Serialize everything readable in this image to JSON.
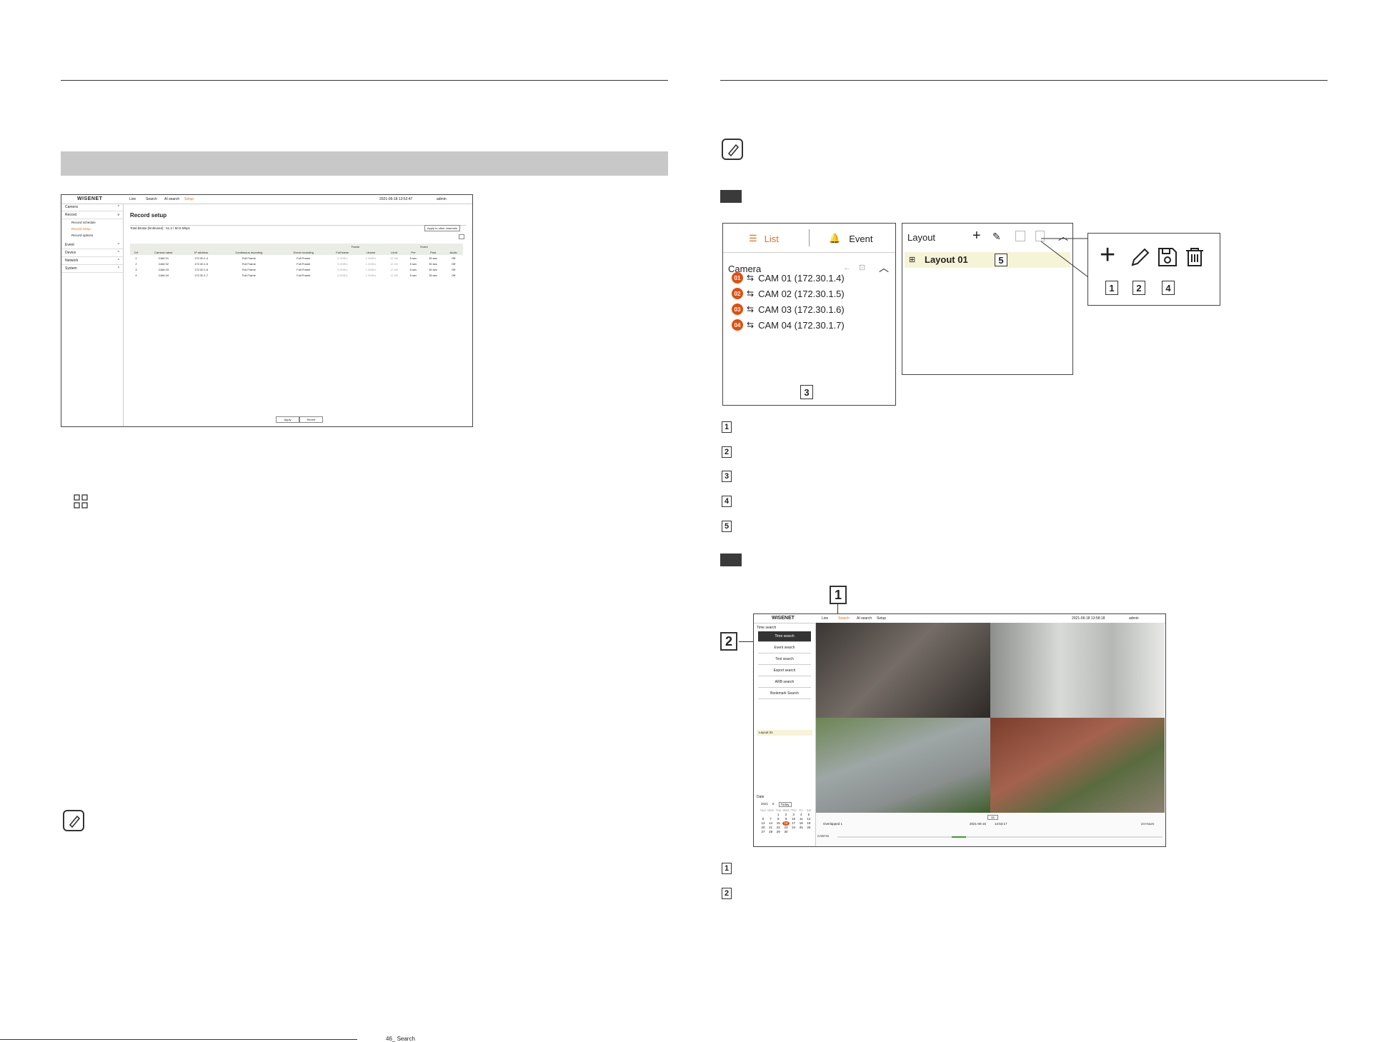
{
  "left_page": {
    "record_setup_screenshot": {
      "brand": "WISENET",
      "nav": [
        "Live",
        "Search",
        "AI search",
        "Setup"
      ],
      "datetime": "2021-06-18 13:52:47",
      "user": "admin",
      "sidebar": [
        {
          "label": "Camera",
          "sub": []
        },
        {
          "label": "Record",
          "sub": [
            "Record schedule",
            "Record setup",
            "Record options"
          ]
        },
        {
          "label": "Event",
          "sub": []
        },
        {
          "label": "Device",
          "sub": []
        },
        {
          "label": "Network",
          "sub": []
        },
        {
          "label": "System",
          "sub": []
        }
      ],
      "title": "Record setup",
      "bitrate_text": "Total bitrate (limit/used) : 51.2 / 50.8 Mbps",
      "apply_other": "Apply to other channels",
      "table_headers": [
        "CH",
        "Camera name",
        "IP address",
        "Continuous recording",
        "Event recording",
        "Full frame",
        "I-frame",
        "Limit",
        "Pre",
        "Post",
        "Audio"
      ],
      "group_headers": {
        "frame": "Frame",
        "event": "Event"
      },
      "rows": [
        [
          "1",
          "CAM 01",
          "172.30.1.4",
          "Full Frame",
          "Full Frame",
          "3.0MB/s",
          "1.0MB/s",
          "12.5M",
          "5 sec",
          "30 sec",
          "Off"
        ],
        [
          "2",
          "CAM 02",
          "172.30.1.5",
          "Full Frame",
          "Full Frame",
          "3.0MB/s",
          "1.0MB/s",
          "12.5M",
          "5 sec",
          "30 sec",
          "Off"
        ],
        [
          "3",
          "CAM 03",
          "172.30.1.6",
          "Full Frame",
          "Full Frame",
          "3.0MB/s",
          "1.0MB/s",
          "12.5M",
          "5 sec",
          "30 sec",
          "Off"
        ],
        [
          "4",
          "CAM 04",
          "172.30.1.7",
          "Full Frame",
          "Full Frame",
          "3.0MB/s",
          "1.0MB/s",
          "12.5M",
          "5 sec",
          "30 sec",
          "Off"
        ]
      ],
      "apply": "Apply",
      "revert": "Revert"
    }
  },
  "right_page": {
    "camera_panel": {
      "tab_list": "List",
      "tab_event": "Event",
      "section": "Camera",
      "cameras": [
        {
          "num": "01",
          "label": "CAM 01 (172.30.1.4)"
        },
        {
          "num": "02",
          "label": "CAM 02 (172.30.1.5)"
        },
        {
          "num": "03",
          "label": "CAM 03 (172.30.1.6)"
        },
        {
          "num": "04",
          "label": "CAM 04 (172.30.1.7)"
        }
      ],
      "callout": "3"
    },
    "layout_panel": {
      "title": "Layout",
      "item": "Layout 01",
      "callout": "5"
    },
    "zoom_callouts": [
      "1",
      "2",
      "4"
    ],
    "legend_numbers": [
      "1",
      "2",
      "3",
      "4",
      "5"
    ],
    "search_screenshot": {
      "brand": "WISENET",
      "nav": [
        "Live",
        "Search",
        "AI search",
        "Setup"
      ],
      "datetime": "2021-06-18 13:58:18",
      "user": "admin",
      "side_title": "Time search",
      "buttons": [
        "Time search",
        "Event search",
        "Text search",
        "Export search",
        "ARB search",
        "Bookmark Search"
      ],
      "layout_item": "Layout 01",
      "date_label": "Date",
      "year": "2021",
      "month": "6",
      "today": "Today",
      "weekdays": [
        "Sun",
        "Mon",
        "Tue",
        "Wed",
        "Thu",
        "Fri",
        "Sat"
      ],
      "cal_rows": [
        [
          "",
          "",
          "1",
          "2",
          "3",
          "4",
          "5"
        ],
        [
          "6",
          "7",
          "8",
          "9",
          "10",
          "11",
          "12"
        ],
        [
          "13",
          "14",
          "15",
          "16",
          "17",
          "18",
          "19"
        ],
        [
          "20",
          "21",
          "22",
          "23",
          "24",
          "25",
          "26"
        ],
        [
          "27",
          "28",
          "29",
          "30",
          "",
          "",
          ""
        ]
      ],
      "selected_day": "16",
      "overlap": "Overlapped 1",
      "playback_date": "2021-06-16",
      "playback_time": "13:53:17",
      "hours": "24 Hours",
      "cam_label": "CAM 01",
      "speed": "1x",
      "callout_top": "1",
      "callout_left": "2"
    },
    "bottom_legend": [
      "1",
      "2"
    ]
  },
  "footer": {
    "text": "46_ Search"
  }
}
